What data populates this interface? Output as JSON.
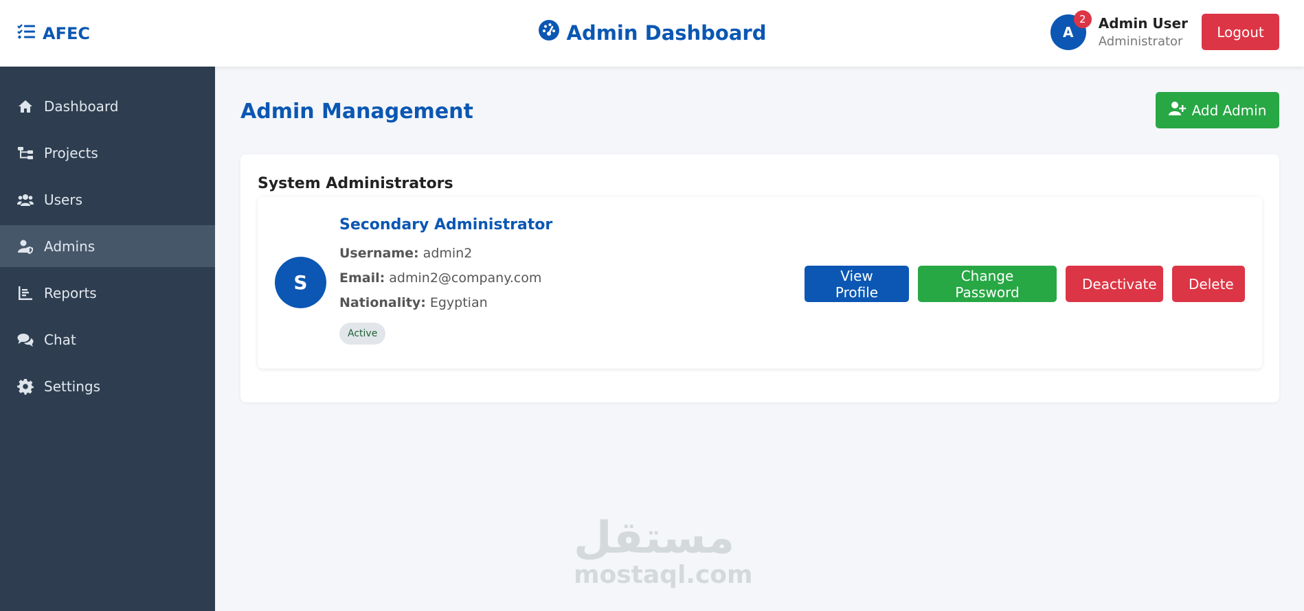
{
  "brand": {
    "name": "AFEC"
  },
  "header": {
    "title": "Admin Dashboard"
  },
  "user": {
    "initial": "A",
    "notification_count": "2",
    "name": "Admin User",
    "role": "Administrator",
    "logout_label": "Logout"
  },
  "sidebar": {
    "items": [
      {
        "label": "Dashboard",
        "icon": "home-icon"
      },
      {
        "label": "Projects",
        "icon": "sitemap-icon"
      },
      {
        "label": "Users",
        "icon": "users-icon"
      },
      {
        "label": "Admins",
        "icon": "user-shield-icon",
        "active": true
      },
      {
        "label": "Reports",
        "icon": "chart-icon"
      },
      {
        "label": "Chat",
        "icon": "comments-icon"
      },
      {
        "label": "Settings",
        "icon": "gear-icon"
      }
    ]
  },
  "main": {
    "title": "Admin Management",
    "add_button_label": "Add Admin",
    "panel_title": "System Administrators",
    "admins": [
      {
        "initial": "S",
        "name": "Secondary Administrator",
        "username_label": "Username:",
        "username": "admin2",
        "email_label": "Email:",
        "email": "admin2@company.com",
        "nationality_label": "Nationality:",
        "nationality": "Egyptian",
        "status": "Active",
        "actions": {
          "view": "View Profile",
          "change_password": "Change Password",
          "deactivate": "Deactivate",
          "delete": "Delete"
        }
      }
    ]
  },
  "watermark": {
    "arabic": "مستقل",
    "latin": "mostaql.com"
  },
  "colors": {
    "primary": "#0b57b3",
    "success": "#28a745",
    "danger": "#dc3545",
    "sidebar_bg": "#2e3e50",
    "sidebar_active": "#46576a"
  }
}
